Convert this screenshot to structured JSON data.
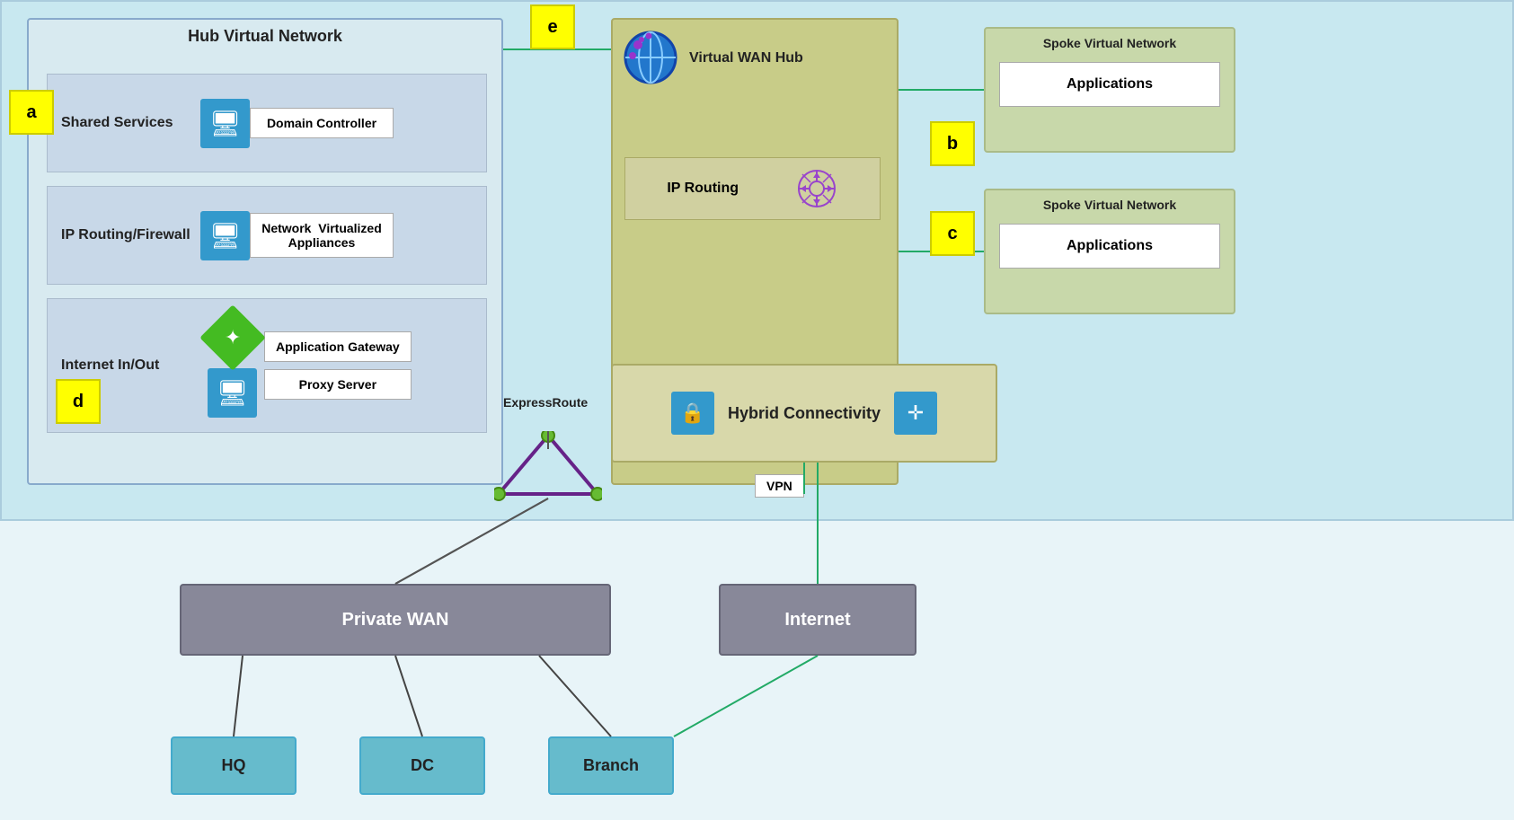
{
  "diagram": {
    "background_color": "#c8e8f0",
    "labels": {
      "a": "a",
      "b": "b",
      "c": "c",
      "d": "d",
      "e": "e"
    },
    "hub_vnet": {
      "title": "Hub Virtual Network",
      "shared_services": {
        "row_label": "Shared Services",
        "component": "Domain Controller"
      },
      "ip_routing_firewall": {
        "row_label": "IP Routing/Firewall",
        "component": "Network  Virtualized\nAppliances"
      },
      "internet_inout": {
        "row_label": "Internet In/Out",
        "component1": "Application Gateway",
        "component2": "Proxy Server"
      }
    },
    "vwan_hub": {
      "title": "Virtual WAN Hub",
      "routing": {
        "label": "IP Routing"
      }
    },
    "hybrid_connectivity": {
      "title": "Hybrid\nConnectivity"
    },
    "vpn": {
      "label": "VPN"
    },
    "expressroute": {
      "label": "ExpressRoute"
    },
    "spoke_vnet_1": {
      "title": "Spoke Virtual Network",
      "apps": "Applications"
    },
    "spoke_vnet_2": {
      "title": "Spoke Virtual Network",
      "apps": "Applications"
    },
    "private_wan": {
      "label": "Private WAN"
    },
    "internet_node": {
      "label": "Internet"
    },
    "hq": {
      "label": "HQ"
    },
    "dc": {
      "label": "DC"
    },
    "branch": {
      "label": "Branch"
    }
  }
}
